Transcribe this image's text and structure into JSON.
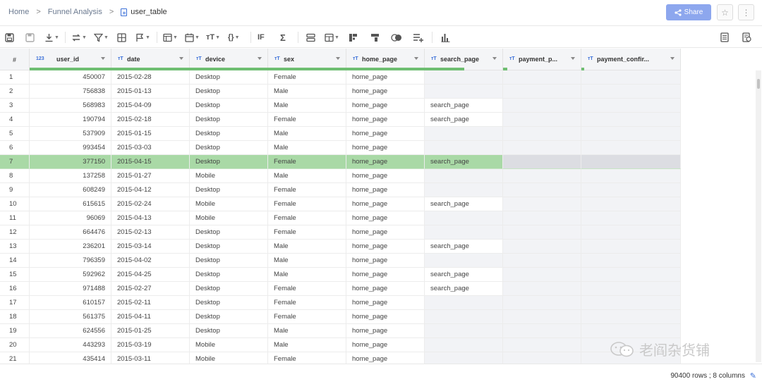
{
  "breadcrumb": {
    "home": "Home",
    "sep1": ">",
    "project": "Funnel Analysis",
    "sep2": ">",
    "current": "user_table"
  },
  "header_actions": {
    "share_label": "Share",
    "share_icon": "<",
    "star_icon": "☆",
    "more_icon": "⋮"
  },
  "toolbar": {
    "sum_icon": "Σ",
    "if_icon": "IF",
    "json_icon": "{}",
    "text_icon": "тT"
  },
  "table": {
    "index_header": "#",
    "columns": [
      {
        "name": "user_id",
        "type": "123"
      },
      {
        "name": "date",
        "type": "тT"
      },
      {
        "name": "device",
        "type": "тT"
      },
      {
        "name": "sex",
        "type": "тT"
      },
      {
        "name": "home_page",
        "type": "тT"
      },
      {
        "name": "search_page",
        "type": "тT"
      },
      {
        "name": "payment_p...",
        "type": "тT"
      },
      {
        "name": "payment_confir...",
        "type": "тT"
      }
    ],
    "rows": [
      {
        "i": "1",
        "user_id": "450007",
        "date": "2015-02-28",
        "device": "Desktop",
        "sex": "Female",
        "home_page": "home_page",
        "search_page": ""
      },
      {
        "i": "2",
        "user_id": "756838",
        "date": "2015-01-13",
        "device": "Desktop",
        "sex": "Male",
        "home_page": "home_page",
        "search_page": ""
      },
      {
        "i": "3",
        "user_id": "568983",
        "date": "2015-04-09",
        "device": "Desktop",
        "sex": "Male",
        "home_page": "home_page",
        "search_page": "search_page"
      },
      {
        "i": "4",
        "user_id": "190794",
        "date": "2015-02-18",
        "device": "Desktop",
        "sex": "Female",
        "home_page": "home_page",
        "search_page": "search_page"
      },
      {
        "i": "5",
        "user_id": "537909",
        "date": "2015-01-15",
        "device": "Desktop",
        "sex": "Male",
        "home_page": "home_page",
        "search_page": ""
      },
      {
        "i": "6",
        "user_id": "993454",
        "date": "2015-03-03",
        "device": "Desktop",
        "sex": "Male",
        "home_page": "home_page",
        "search_page": ""
      },
      {
        "i": "7",
        "user_id": "377150",
        "date": "2015-04-15",
        "device": "Desktop",
        "sex": "Female",
        "home_page": "home_page",
        "search_page": "search_page"
      },
      {
        "i": "8",
        "user_id": "137258",
        "date": "2015-01-27",
        "device": "Mobile",
        "sex": "Male",
        "home_page": "home_page",
        "search_page": ""
      },
      {
        "i": "9",
        "user_id": "608249",
        "date": "2015-04-12",
        "device": "Desktop",
        "sex": "Female",
        "home_page": "home_page",
        "search_page": ""
      },
      {
        "i": "10",
        "user_id": "615615",
        "date": "2015-02-24",
        "device": "Mobile",
        "sex": "Female",
        "home_page": "home_page",
        "search_page": "search_page"
      },
      {
        "i": "11",
        "user_id": "96069",
        "date": "2015-04-13",
        "device": "Mobile",
        "sex": "Female",
        "home_page": "home_page",
        "search_page": ""
      },
      {
        "i": "12",
        "user_id": "664476",
        "date": "2015-02-13",
        "device": "Desktop",
        "sex": "Female",
        "home_page": "home_page",
        "search_page": ""
      },
      {
        "i": "13",
        "user_id": "236201",
        "date": "2015-03-14",
        "device": "Desktop",
        "sex": "Male",
        "home_page": "home_page",
        "search_page": "search_page"
      },
      {
        "i": "14",
        "user_id": "796359",
        "date": "2015-04-02",
        "device": "Desktop",
        "sex": "Male",
        "home_page": "home_page",
        "search_page": ""
      },
      {
        "i": "15",
        "user_id": "592962",
        "date": "2015-04-25",
        "device": "Desktop",
        "sex": "Male",
        "home_page": "home_page",
        "search_page": "search_page"
      },
      {
        "i": "16",
        "user_id": "971488",
        "date": "2015-02-27",
        "device": "Desktop",
        "sex": "Female",
        "home_page": "home_page",
        "search_page": "search_page"
      },
      {
        "i": "17",
        "user_id": "610157",
        "date": "2015-02-11",
        "device": "Desktop",
        "sex": "Female",
        "home_page": "home_page",
        "search_page": ""
      },
      {
        "i": "18",
        "user_id": "561375",
        "date": "2015-04-11",
        "device": "Desktop",
        "sex": "Female",
        "home_page": "home_page",
        "search_page": ""
      },
      {
        "i": "19",
        "user_id": "624556",
        "date": "2015-01-25",
        "device": "Desktop",
        "sex": "Male",
        "home_page": "home_page",
        "search_page": ""
      },
      {
        "i": "20",
        "user_id": "443293",
        "date": "2015-03-19",
        "device": "Mobile",
        "sex": "Male",
        "home_page": "home_page",
        "search_page": ""
      },
      {
        "i": "21",
        "user_id": "435414",
        "date": "2015-03-11",
        "device": "Mobile",
        "sex": "Female",
        "home_page": "home_page",
        "search_page": ""
      }
    ],
    "selected_row": 7
  },
  "status": {
    "summary": "90400 rows ; 8 columns",
    "edit_icon": "✎"
  },
  "watermark": {
    "text": "老阎杂货铺",
    "icon": "wechat-icon"
  },
  "colors": {
    "accent": "#3a6fd8",
    "share_button": "#8da7ee",
    "selected_row": "#a9d9a6",
    "fill_bar": "#6fbe72"
  }
}
